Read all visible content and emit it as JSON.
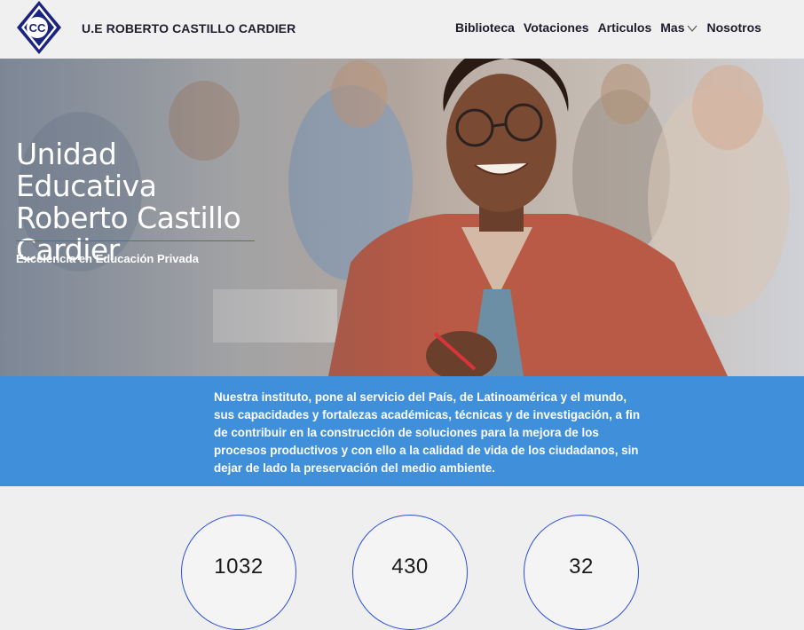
{
  "header": {
    "logo_text": "CC",
    "brand": "U.E ROBERTO CASTILLO CARDIER",
    "nav": [
      {
        "label": "Biblioteca"
      },
      {
        "label": "Votaciones"
      },
      {
        "label": "Articulos"
      },
      {
        "label": "Mas"
      },
      {
        "label": "Nosotros"
      }
    ]
  },
  "hero": {
    "title": "Unidad Educativa Roberto Castillo Cardier",
    "subtitle": "Excelencia en Educación Privada"
  },
  "mission": {
    "text": "Nuestra instituto, pone al servicio del País, de Latinoamérica y el mundo, sus capacidades y fortalezas académicas, técnicas y de investigación, a fin de contribuir en la construcción de soluciones para la mejora de los procesos productivos y con ello a la calidad de vida de los ciudadanos, sin dejar de lado la preservación del medio ambiente."
  },
  "stats": [
    {
      "value": "1032"
    },
    {
      "value": "430"
    },
    {
      "value": "32"
    }
  ],
  "colors": {
    "accent_blue": "#3f8fdb",
    "stat_border": "#2b50d6",
    "logo_navy": "#1a237e"
  }
}
